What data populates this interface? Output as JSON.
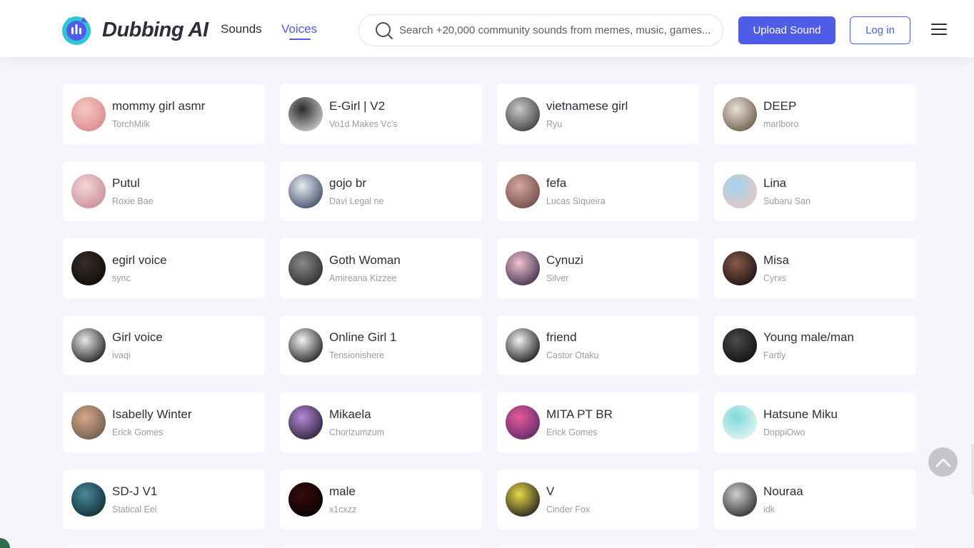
{
  "brand": {
    "name": "Dubbing AI"
  },
  "nav": {
    "sounds_label": "Sounds",
    "voices_label": "Voices",
    "active": "Voices"
  },
  "search": {
    "placeholder": "Search +20,000 community sounds from memes, music, games..."
  },
  "actions": {
    "upload_label": "Upload Sound",
    "login_label": "Log in"
  },
  "icons": [
    "logo-icon",
    "search-icon",
    "hamburger-menu-icon",
    "chevron-up-icon"
  ],
  "colors": {
    "accent": "#4f5ce8",
    "page_bg": "#f4f6fb",
    "card_bg": "#ffffff",
    "title_text": "#2c2f3a",
    "muted_text": "#9a9ca6"
  },
  "voices": [
    {
      "title": "mommy girl asmr",
      "author": "TorchMilk",
      "avatar_colors": [
        "#f6c9c4",
        "#d98a8a"
      ]
    },
    {
      "title": "E-Girl | V2",
      "author": "Vo1d Makes Vc's",
      "avatar_colors": [
        "#2a2a2a",
        "#cfcfcf"
      ]
    },
    {
      "title": "vietnamese girl",
      "author": "Ryu",
      "avatar_colors": [
        "#c9c9c9",
        "#3b3b3b"
      ]
    },
    {
      "title": "DEEP",
      "author": "marlboro",
      "avatar_colors": [
        "#e9e2d6",
        "#6b5a4a"
      ]
    },
    {
      "title": "Putul",
      "author": "Roxie Bae",
      "avatar_colors": [
        "#f5d6d9",
        "#c98c96"
      ]
    },
    {
      "title": "gojo br",
      "author": "Davi Legal ne",
      "avatar_colors": [
        "#e6ecf2",
        "#3c4a66"
      ]
    },
    {
      "title": "fefa",
      "author": "Lucas Siqueira",
      "avatar_colors": [
        "#d7a6a0",
        "#6e4a46"
      ]
    },
    {
      "title": "Lina",
      "author": "Subaru San",
      "avatar_colors": [
        "#9fd3f0",
        "#e9c7c1"
      ]
    },
    {
      "title": "egirl voice",
      "author": "sync",
      "avatar_colors": [
        "#3a2d28",
        "#0d0b0a"
      ]
    },
    {
      "title": "Goth Woman",
      "author": "Amireana Kizzee",
      "avatar_colors": [
        "#8a8a8a",
        "#2b2b2b"
      ]
    },
    {
      "title": "Cynuzi",
      "author": "Silver",
      "avatar_colors": [
        "#f3c2d0",
        "#3c2c4a"
      ]
    },
    {
      "title": "Misa",
      "author": "Cyrxs",
      "avatar_colors": [
        "#8a5a4a",
        "#1a1212"
      ]
    },
    {
      "title": "Girl voice",
      "author": "ivaqi",
      "avatar_colors": [
        "#e8e8e8",
        "#1c1c1c"
      ]
    },
    {
      "title": "Online Girl 1",
      "author": "Tensionishere",
      "avatar_colors": [
        "#f2f2f2",
        "#1c1c1c"
      ]
    },
    {
      "title": "friend",
      "author": "Castor Otaku",
      "avatar_colors": [
        "#f2f2f2",
        "#141414"
      ]
    },
    {
      "title": "Young male/man",
      "author": "Fartly",
      "avatar_colors": [
        "#4a4a4a",
        "#0f0f0f"
      ]
    },
    {
      "title": "Isabelly Winter",
      "author": "Erick Gomes",
      "avatar_colors": [
        "#d6a88c",
        "#6b5a4a"
      ]
    },
    {
      "title": "Mikaela",
      "author": "Chorizumzum",
      "avatar_colors": [
        "#b48ad8",
        "#2a1f35"
      ]
    },
    {
      "title": "MITA PT BR",
      "author": "Erick Gomes",
      "avatar_colors": [
        "#e85a9a",
        "#5a2a6a"
      ]
    },
    {
      "title": "Hatsune Miku",
      "author": "DoppiOwo",
      "avatar_colors": [
        "#7fd9d9",
        "#e8f4f4"
      ]
    },
    {
      "title": "SD-J V1",
      "author": "Statical Eel",
      "avatar_colors": [
        "#4a8a9a",
        "#0f2a35"
      ]
    },
    {
      "title": "male",
      "author": "x1cxzz",
      "avatar_colors": [
        "#3a0a0a",
        "#050505"
      ]
    },
    {
      "title": "V",
      "author": "Cinder Fox",
      "avatar_colors": [
        "#e8d84a",
        "#1c1c1c"
      ]
    },
    {
      "title": "Nouraa",
      "author": "idk",
      "avatar_colors": [
        "#cfcfcf",
        "#2b2b2b"
      ]
    }
  ]
}
